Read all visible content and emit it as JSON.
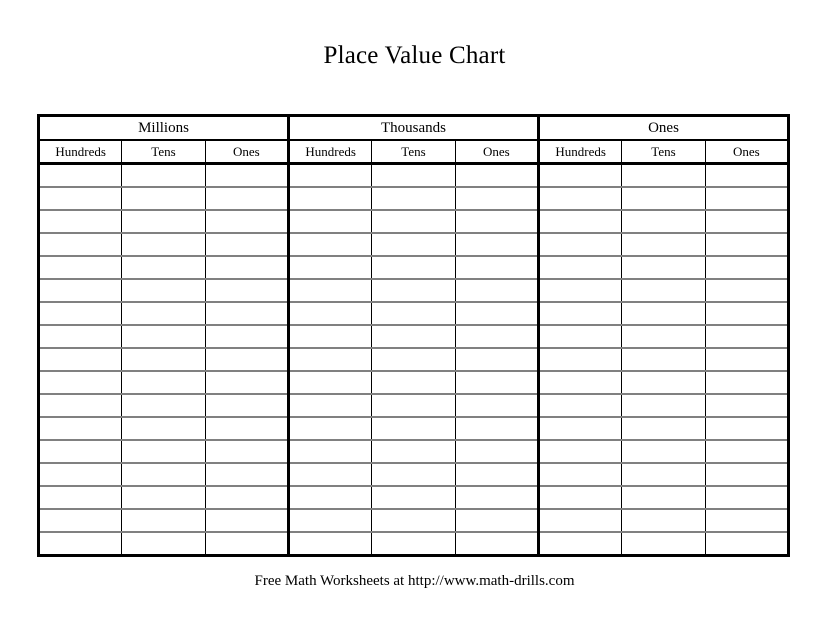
{
  "document": {
    "title": "Place Value Chart",
    "footer": "Free Math Worksheets at http://www.math-drills.com"
  },
  "chart_data": {
    "type": "table",
    "title": "Place Value Chart",
    "grid": true,
    "group_headers": [
      "Millions",
      "Thousands",
      "Ones"
    ],
    "column_headers": [
      "Hundreds",
      "Tens",
      "Ones",
      "Hundreds",
      "Tens",
      "Ones",
      "Hundreds",
      "Tens",
      "Ones"
    ],
    "columns_per_group": 3,
    "data_row_count": 17,
    "rows": [
      [
        "",
        "",
        "",
        "",
        "",
        "",
        "",
        "",
        ""
      ],
      [
        "",
        "",
        "",
        "",
        "",
        "",
        "",
        "",
        ""
      ],
      [
        "",
        "",
        "",
        "",
        "",
        "",
        "",
        "",
        ""
      ],
      [
        "",
        "",
        "",
        "",
        "",
        "",
        "",
        "",
        ""
      ],
      [
        "",
        "",
        "",
        "",
        "",
        "",
        "",
        "",
        ""
      ],
      [
        "",
        "",
        "",
        "",
        "",
        "",
        "",
        "",
        ""
      ],
      [
        "",
        "",
        "",
        "",
        "",
        "",
        "",
        "",
        ""
      ],
      [
        "",
        "",
        "",
        "",
        "",
        "",
        "",
        "",
        ""
      ],
      [
        "",
        "",
        "",
        "",
        "",
        "",
        "",
        "",
        ""
      ],
      [
        "",
        "",
        "",
        "",
        "",
        "",
        "",
        "",
        ""
      ],
      [
        "",
        "",
        "",
        "",
        "",
        "",
        "",
        "",
        ""
      ],
      [
        "",
        "",
        "",
        "",
        "",
        "",
        "",
        "",
        ""
      ],
      [
        "",
        "",
        "",
        "",
        "",
        "",
        "",
        "",
        ""
      ],
      [
        "",
        "",
        "",
        "",
        "",
        "",
        "",
        "",
        ""
      ],
      [
        "",
        "",
        "",
        "",
        "",
        "",
        "",
        "",
        ""
      ],
      [
        "",
        "",
        "",
        "",
        "",
        "",
        "",
        "",
        ""
      ],
      [
        "",
        "",
        "",
        "",
        "",
        "",
        "",
        "",
        ""
      ]
    ],
    "colors": {
      "border": "#000000",
      "row_divider": "#808080",
      "background": "#ffffff",
      "text": "#000000"
    }
  }
}
